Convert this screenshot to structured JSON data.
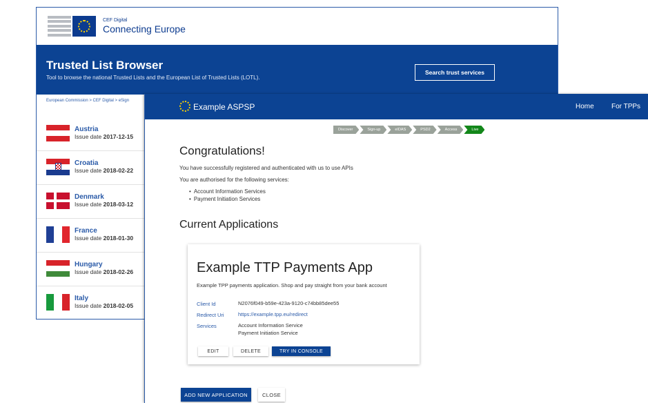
{
  "back_window": {
    "brand_small": "CEF Digital",
    "brand_big": "Connecting Europe",
    "banner_title": "Trusted List Browser",
    "banner_subtitle": "Tool to browse the national Trusted Lists and the European List of Trusted Lists (LOTL).",
    "search_button": "Search trust services",
    "breadcrumb": "European Commission  >  CEF Digital  >  eSign",
    "countries": [
      {
        "name": "Austria",
        "issue_label": "Issue date",
        "issue_date": "2017-12-15",
        "flag": "austria"
      },
      {
        "name": "Croatia",
        "issue_label": "Issue date",
        "issue_date": "2018-02-22",
        "flag": "croatia"
      },
      {
        "name": "Denmark",
        "issue_label": "Issue date",
        "issue_date": "2018-03-12",
        "flag": "denmark"
      },
      {
        "name": "France",
        "issue_label": "Issue date",
        "issue_date": "2018-01-30",
        "flag": "france"
      },
      {
        "name": "Hungary",
        "issue_label": "Issue date",
        "issue_date": "2018-02-26",
        "flag": "hungary"
      },
      {
        "name": "Italy",
        "issue_label": "Issue date",
        "issue_date": "2018-02-05",
        "flag": "italy"
      }
    ]
  },
  "front_window": {
    "app_title": "Example ASPSP",
    "nav": {
      "home": "Home",
      "for_tpps": "For TPPs"
    },
    "steps": [
      "Discover",
      "Sign-up",
      "eIDAS",
      "PSD2",
      "Access",
      "Live"
    ],
    "active_step": "Live",
    "heading": "Congratulations!",
    "message1": "You have successfully registered and authenticated with us to use APIs",
    "message2": "You are authorised for the following services:",
    "services": [
      "Account Information Services",
      "Payment Initiation Services"
    ],
    "current_apps_heading": "Current Applications",
    "app": {
      "name": "Example TTP Payments App",
      "description": "Example TPP payments application. Shop and pay straight from your bank account",
      "client_id_label": "Client Id",
      "client_id": "N2076f049-b59e-423a-9120-c74bb85dee55",
      "redirect_label": "Redirect Uri",
      "redirect_uri": "https://example.tpp.eu/redirect",
      "services_label": "Services",
      "services": [
        "Account Information Service",
        "Payment Initiation Service"
      ],
      "buttons": {
        "edit": "EDIT",
        "delete": "DELETE",
        "console": "TRY IN CONSOLE"
      }
    },
    "add_button": "ADD NEW APPLICATION",
    "close_button": "CLOSE"
  },
  "colors": {
    "brand_blue": "#0c4393",
    "link_blue": "#2a5aa8",
    "step_active": "#13871a",
    "step_inactive": "#9aa29a",
    "eu_star_yellow": "#ffd300"
  }
}
